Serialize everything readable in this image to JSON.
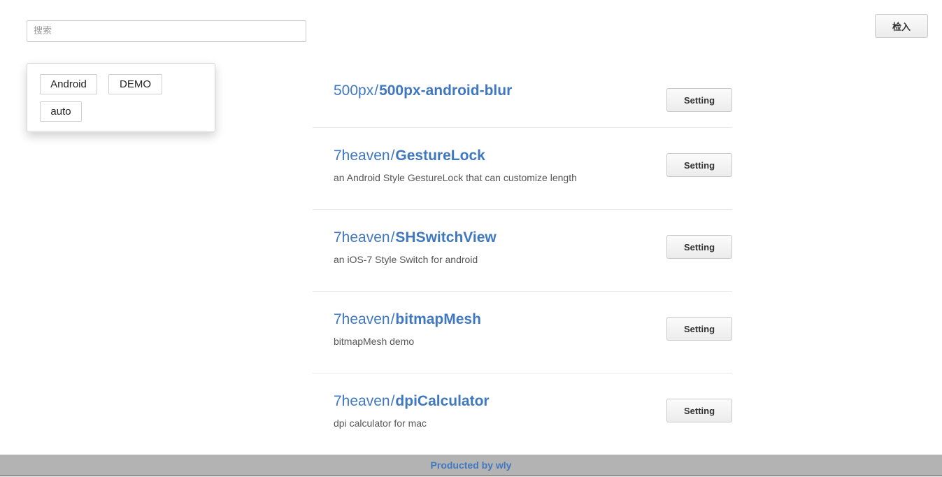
{
  "search": {
    "placeholder": "搜索",
    "value": ""
  },
  "header": {
    "checkin_label": "检入"
  },
  "tags": [
    "Android",
    "DEMO",
    "auto"
  ],
  "repos": [
    {
      "owner": "500px",
      "separator": "/",
      "name": "500px-android-blur",
      "description": "",
      "setting_label": "Setting"
    },
    {
      "owner": "7heaven",
      "separator": "/",
      "name": "GestureLock",
      "description": "an Android Style GestureLock that can customize length",
      "setting_label": "Setting"
    },
    {
      "owner": "7heaven",
      "separator": "/",
      "name": "SHSwitchView",
      "description": "an iOS-7 Style Switch for android",
      "setting_label": "Setting"
    },
    {
      "owner": "7heaven",
      "separator": "/",
      "name": "bitmapMesh",
      "description": "bitmapMesh demo",
      "setting_label": "Setting"
    },
    {
      "owner": "7heaven",
      "separator": "/",
      "name": "dpiCalculator",
      "description": "dpi calculator for mac",
      "setting_label": "Setting"
    }
  ],
  "footer": {
    "text": "Producted by wly"
  },
  "colors": {
    "link": "#4078c0",
    "footer_bg": "#b3b3b3"
  }
}
